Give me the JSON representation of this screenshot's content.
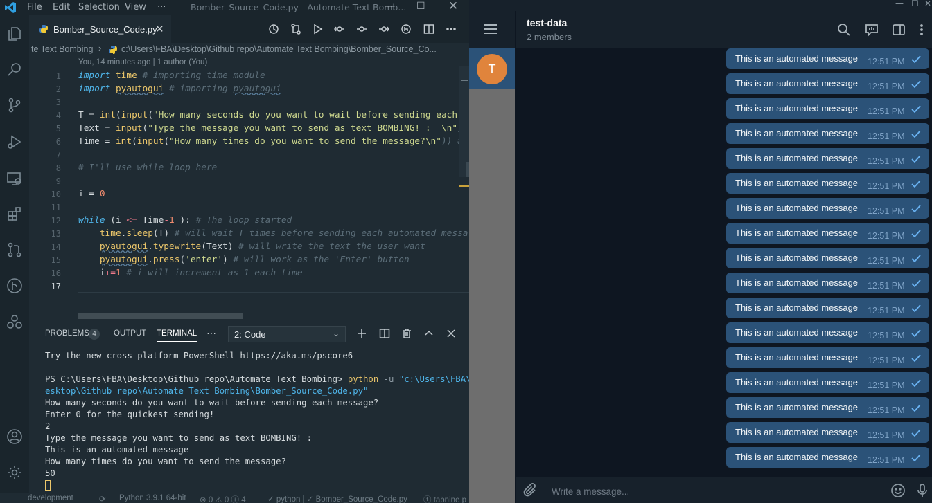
{
  "vscode": {
    "menu": [
      "File",
      "Edit",
      "Selection",
      "View",
      "···"
    ],
    "window_title": "Bomber_Source_Code.py - Automate Text Bomb...",
    "tab_name": "Bomber_Source_Code.py",
    "breadcrumb_folder": "te Text Bombing",
    "breadcrumb_path": "c:\\Users\\FBA\\Desktop\\Github repo\\Automate Text Bombing\\Bomber_Source_Co...",
    "codelens": "You, 14 minutes ago | 1 author (You)",
    "line_numbers": [
      "1",
      "2",
      "3",
      "4",
      "5",
      "6",
      "7",
      "8",
      "9",
      "10",
      "11",
      "12",
      "13",
      "14",
      "15",
      "16",
      "17"
    ],
    "panel": {
      "problems_label": "PROBLEMS",
      "problems_count": "4",
      "output_label": "OUTPUT",
      "terminal_label": "TERMINAL",
      "more": "···",
      "terminal_select": "2: Code"
    },
    "terminal": {
      "line1": "Try the new cross-platform PowerShell https://aka.ms/pscore6",
      "prompt": "PS C:\\Users\\FBA\\Desktop\\Github repo\\Automate Text Bombing> ",
      "cmd": "python",
      "flag": " -u ",
      "path1": "\"c:\\Users\\FBA\\D",
      "path2": "esktop\\Github repo\\Automate Text Bombing\\Bomber_Source_Code.py\"",
      "out1": "How many seconds do you want to wait before sending each message?",
      "out2": "Enter 0 for the quickest sending!",
      "out3": "2",
      "out4": "Type the message you want to send as text BOMBING! :",
      "out5": "This is an automated message",
      "out6": "How many times do you want to send the message?",
      "out7": "50"
    },
    "status": {
      "branch": "development",
      "python": "Python 3.9.1 64-bit",
      "errors": "⊗ 0  ⚠ 0  ⓘ 4",
      "file": "✓ python | ✓ Bomber_Source_Code.py",
      "tabnine": "ⓣ tabnine p"
    }
  },
  "telegram": {
    "chat_name": "test-data",
    "members": "2 members",
    "avatar_letter": "T",
    "input_placeholder": "Write a message...",
    "messages": [
      {
        "text": "This is an automated message",
        "time": "12:51 PM"
      },
      {
        "text": "This is an automated message",
        "time": "12:51 PM"
      },
      {
        "text": "This is an automated message",
        "time": "12:51 PM"
      },
      {
        "text": "This is an automated message",
        "time": "12:51 PM"
      },
      {
        "text": "This is an automated message",
        "time": "12:51 PM"
      },
      {
        "text": "This is an automated message",
        "time": "12:51 PM"
      },
      {
        "text": "This is an automated message",
        "time": "12:51 PM"
      },
      {
        "text": "This is an automated message",
        "time": "12:51 PM"
      },
      {
        "text": "This is an automated message",
        "time": "12:51 PM"
      },
      {
        "text": "This is an automated message",
        "time": "12:51 PM"
      },
      {
        "text": "This is an automated message",
        "time": "12:51 PM"
      },
      {
        "text": "This is an automated message",
        "time": "12:51 PM"
      },
      {
        "text": "This is an automated message",
        "time": "12:51 PM"
      },
      {
        "text": "This is an automated message",
        "time": "12:51 PM"
      },
      {
        "text": "This is an automated message",
        "time": "12:51 PM"
      },
      {
        "text": "This is an automated message",
        "time": "12:51 PM"
      },
      {
        "text": "This is an automated message",
        "time": "12:51 PM"
      }
    ]
  },
  "code": {
    "l1": [
      "import",
      " ",
      "time",
      " # importing time module"
    ],
    "l2": [
      "import",
      " ",
      "pyautogui",
      " # importing ",
      "pyautogui"
    ],
    "l4": [
      "T = ",
      "int",
      "(",
      "input",
      "(",
      "\"How many seconds do you want to wait before sending each me"
    ],
    "l5": [
      "Text = ",
      "input",
      "(",
      "\"Type the message you want to send as text BOMBING! :  \\n\"",
      ") #"
    ],
    "l6": [
      "Time = ",
      "int",
      "(",
      "input",
      "(",
      "\"How many times do you want to send the message?\\n\"",
      ")) # i"
    ],
    "l8": "# I'll use while loop here",
    "l10": [
      "i = ",
      "0"
    ],
    "l12": [
      "while",
      " (i ",
      "<=",
      " Time",
      "-",
      "1",
      " ): ",
      "# The loop started"
    ],
    "l13": [
      "    ",
      "time",
      ".",
      "sleep",
      "(T) ",
      "# will wait T times before sending each automated messa"
    ],
    "l14": [
      "    ",
      "pyautogui",
      ".",
      "typewrite",
      "(Text) ",
      "# will write the text the user want"
    ],
    "l15": [
      "    ",
      "pyautogui",
      ".",
      "press",
      "(",
      "'enter'",
      ") ",
      "# will work as the 'Enter' button"
    ],
    "l16": [
      "    i",
      "+=",
      "1",
      " ",
      "# i will increment as 1 each time"
    ]
  },
  "colors": {
    "vscode_bg": "#1f2b33",
    "telegram_bg": "#0e1621",
    "bubble": "#2b5278",
    "check": "#6ab3f3",
    "avatar": "#e0843c"
  }
}
